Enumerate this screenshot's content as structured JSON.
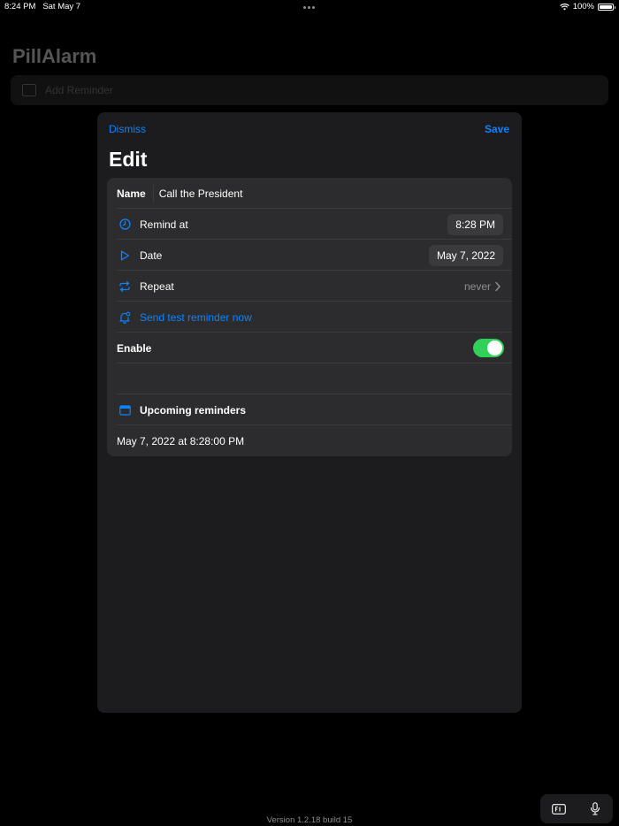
{
  "status": {
    "time": "8:24 PM",
    "date": "Sat May 7",
    "battery": "100%"
  },
  "background": {
    "app_title": "PillAlarm",
    "add_placeholder": "Add Reminder"
  },
  "sheet": {
    "dismiss": "Dismiss",
    "save": "Save",
    "title": "Edit"
  },
  "form": {
    "name_label": "Name",
    "name_value": "Call the President",
    "remind_label": "Remind at",
    "remind_value": "8:28 PM",
    "date_label": "Date",
    "date_value": "May 7, 2022",
    "repeat_label": "Repeat",
    "repeat_value": "never",
    "test_label": "Send test reminder now",
    "enable_label": "Enable",
    "enabled": true,
    "upcoming_label": "Upcoming reminders",
    "upcoming_items": [
      "May 7, 2022 at 8:28:00 PM"
    ]
  },
  "footer": {
    "version": "Version 1.2.18 build 15"
  },
  "colors": {
    "accent": "#0a84ff",
    "toggle_on": "#30d158",
    "sheet_bg": "#1c1c1e",
    "group_bg": "#2c2c2e"
  }
}
